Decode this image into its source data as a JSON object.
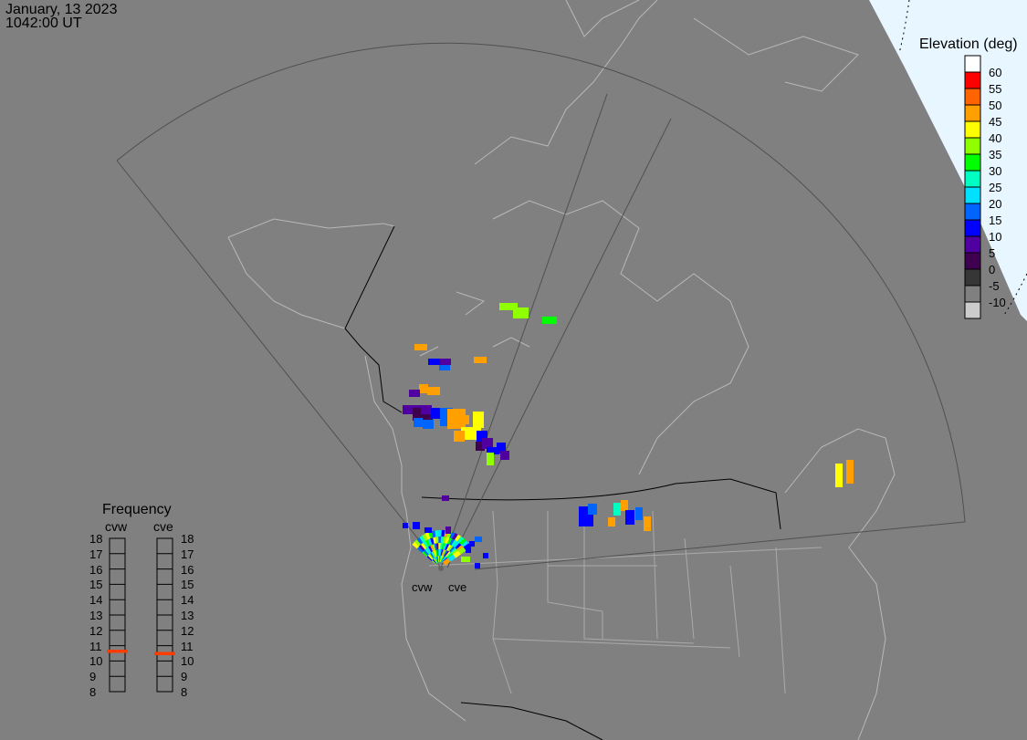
{
  "header": {
    "date": "January, 13 2023",
    "time": "1042:00 UT"
  },
  "colorbar": {
    "title": "Elevation (deg)",
    "colors": [
      "#ffffff",
      "#ff0000",
      "#ff6400",
      "#ffa000",
      "#ffff00",
      "#90ff00",
      "#00ff00",
      "#00ffc0",
      "#00e0ff",
      "#0064ff",
      "#0000ff",
      "#5000a0",
      "#400050",
      "#363636",
      "#808080",
      "#cccccc"
    ],
    "labels": [
      "60",
      "55",
      "50",
      "45",
      "40",
      "35",
      "30",
      "25",
      "20",
      "15",
      "10",
      "5",
      "0",
      "-5",
      "-10"
    ]
  },
  "frequency": {
    "title": "Frequency",
    "radars": [
      {
        "name": "cvw",
        "value_mhz": 10.65
      },
      {
        "name": "cve",
        "value_mhz": 10.5
      }
    ],
    "ticks": [
      "18",
      "17",
      "16",
      "15",
      "14",
      "13",
      "12",
      "11",
      "10",
      "9",
      "8"
    ],
    "marker_color": "#ff3c00"
  },
  "radar_labels": [
    "cvw",
    "cve"
  ]
}
